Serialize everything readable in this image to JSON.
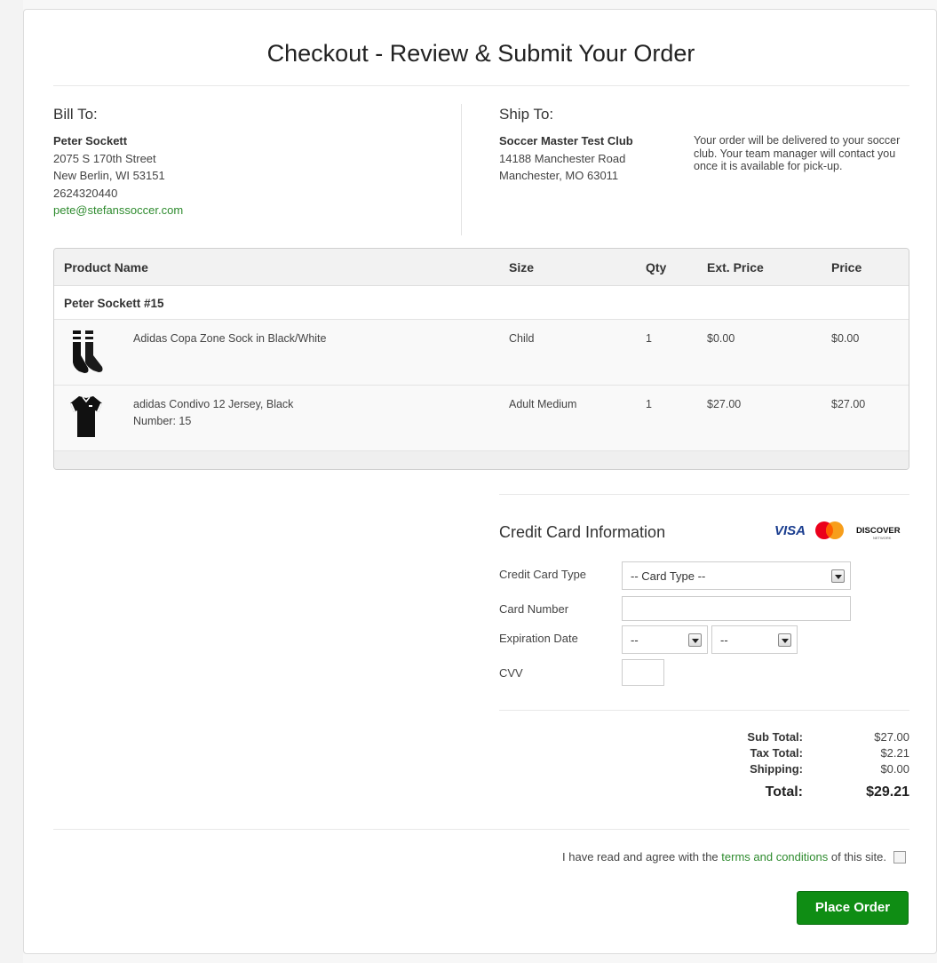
{
  "page": {
    "title": "Checkout - Review & Submit Your Order"
  },
  "bill_to": {
    "heading": "Bill To:",
    "name": "Peter Sockett",
    "street": "2075 S 170th Street",
    "city": "New Berlin, WI 53151",
    "phone": "2624320440",
    "email": "pete@stefanssoccer.com"
  },
  "ship_to": {
    "heading": "Ship To:",
    "name": "Soccer Master Test Club",
    "street": "14188 Manchester Road",
    "city": "Manchester, MO 63011",
    "note": "Your order will be delivered to your soccer club. Your team manager will contact you once it is available for pick-up."
  },
  "table": {
    "headers": {
      "product": "Product Name",
      "size": "Size",
      "qty": "Qty",
      "ext_price": "Ext. Price",
      "price": "Price"
    },
    "group_label": "Peter Sockett #15",
    "rows": [
      {
        "name": "Adidas Copa Zone Sock in Black/White",
        "detail": "",
        "size": "Child",
        "qty": "1",
        "ext_price": "$0.00",
        "price": "$0.00",
        "image": "sock-icon"
      },
      {
        "name": "adidas Condivo 12 Jersey, Black",
        "detail": "Number: 15",
        "size": "Adult Medium",
        "qty": "1",
        "ext_price": "$27.00",
        "price": "$27.00",
        "image": "jersey-icon"
      }
    ]
  },
  "credit_card": {
    "heading": "Credit Card Information",
    "logos": {
      "visa": "VISA",
      "discover": "DISCOVER",
      "discover_sub": "NETWORK"
    },
    "type_label": "Credit Card Type",
    "type_value": "-- Card Type --",
    "number_label": "Card Number",
    "expiration_label": "Expiration Date",
    "exp_month": "--",
    "exp_year": "--",
    "cvv_label": "CVV"
  },
  "totals": {
    "subtotal_label": "Sub Total:",
    "subtotal": "$27.00",
    "tax_label": "Tax Total:",
    "tax": "$2.21",
    "shipping_label": "Shipping:",
    "shipping": "$0.00",
    "total_label": "Total:",
    "total": "$29.21"
  },
  "agreement": {
    "prefix": "I have read and agree with the",
    "link": "terms and conditions",
    "suffix": "of this site."
  },
  "place_order_label": "Place Order",
  "colors": {
    "accent_green": "#2e8b2e",
    "button_green": "#0f8d14"
  }
}
